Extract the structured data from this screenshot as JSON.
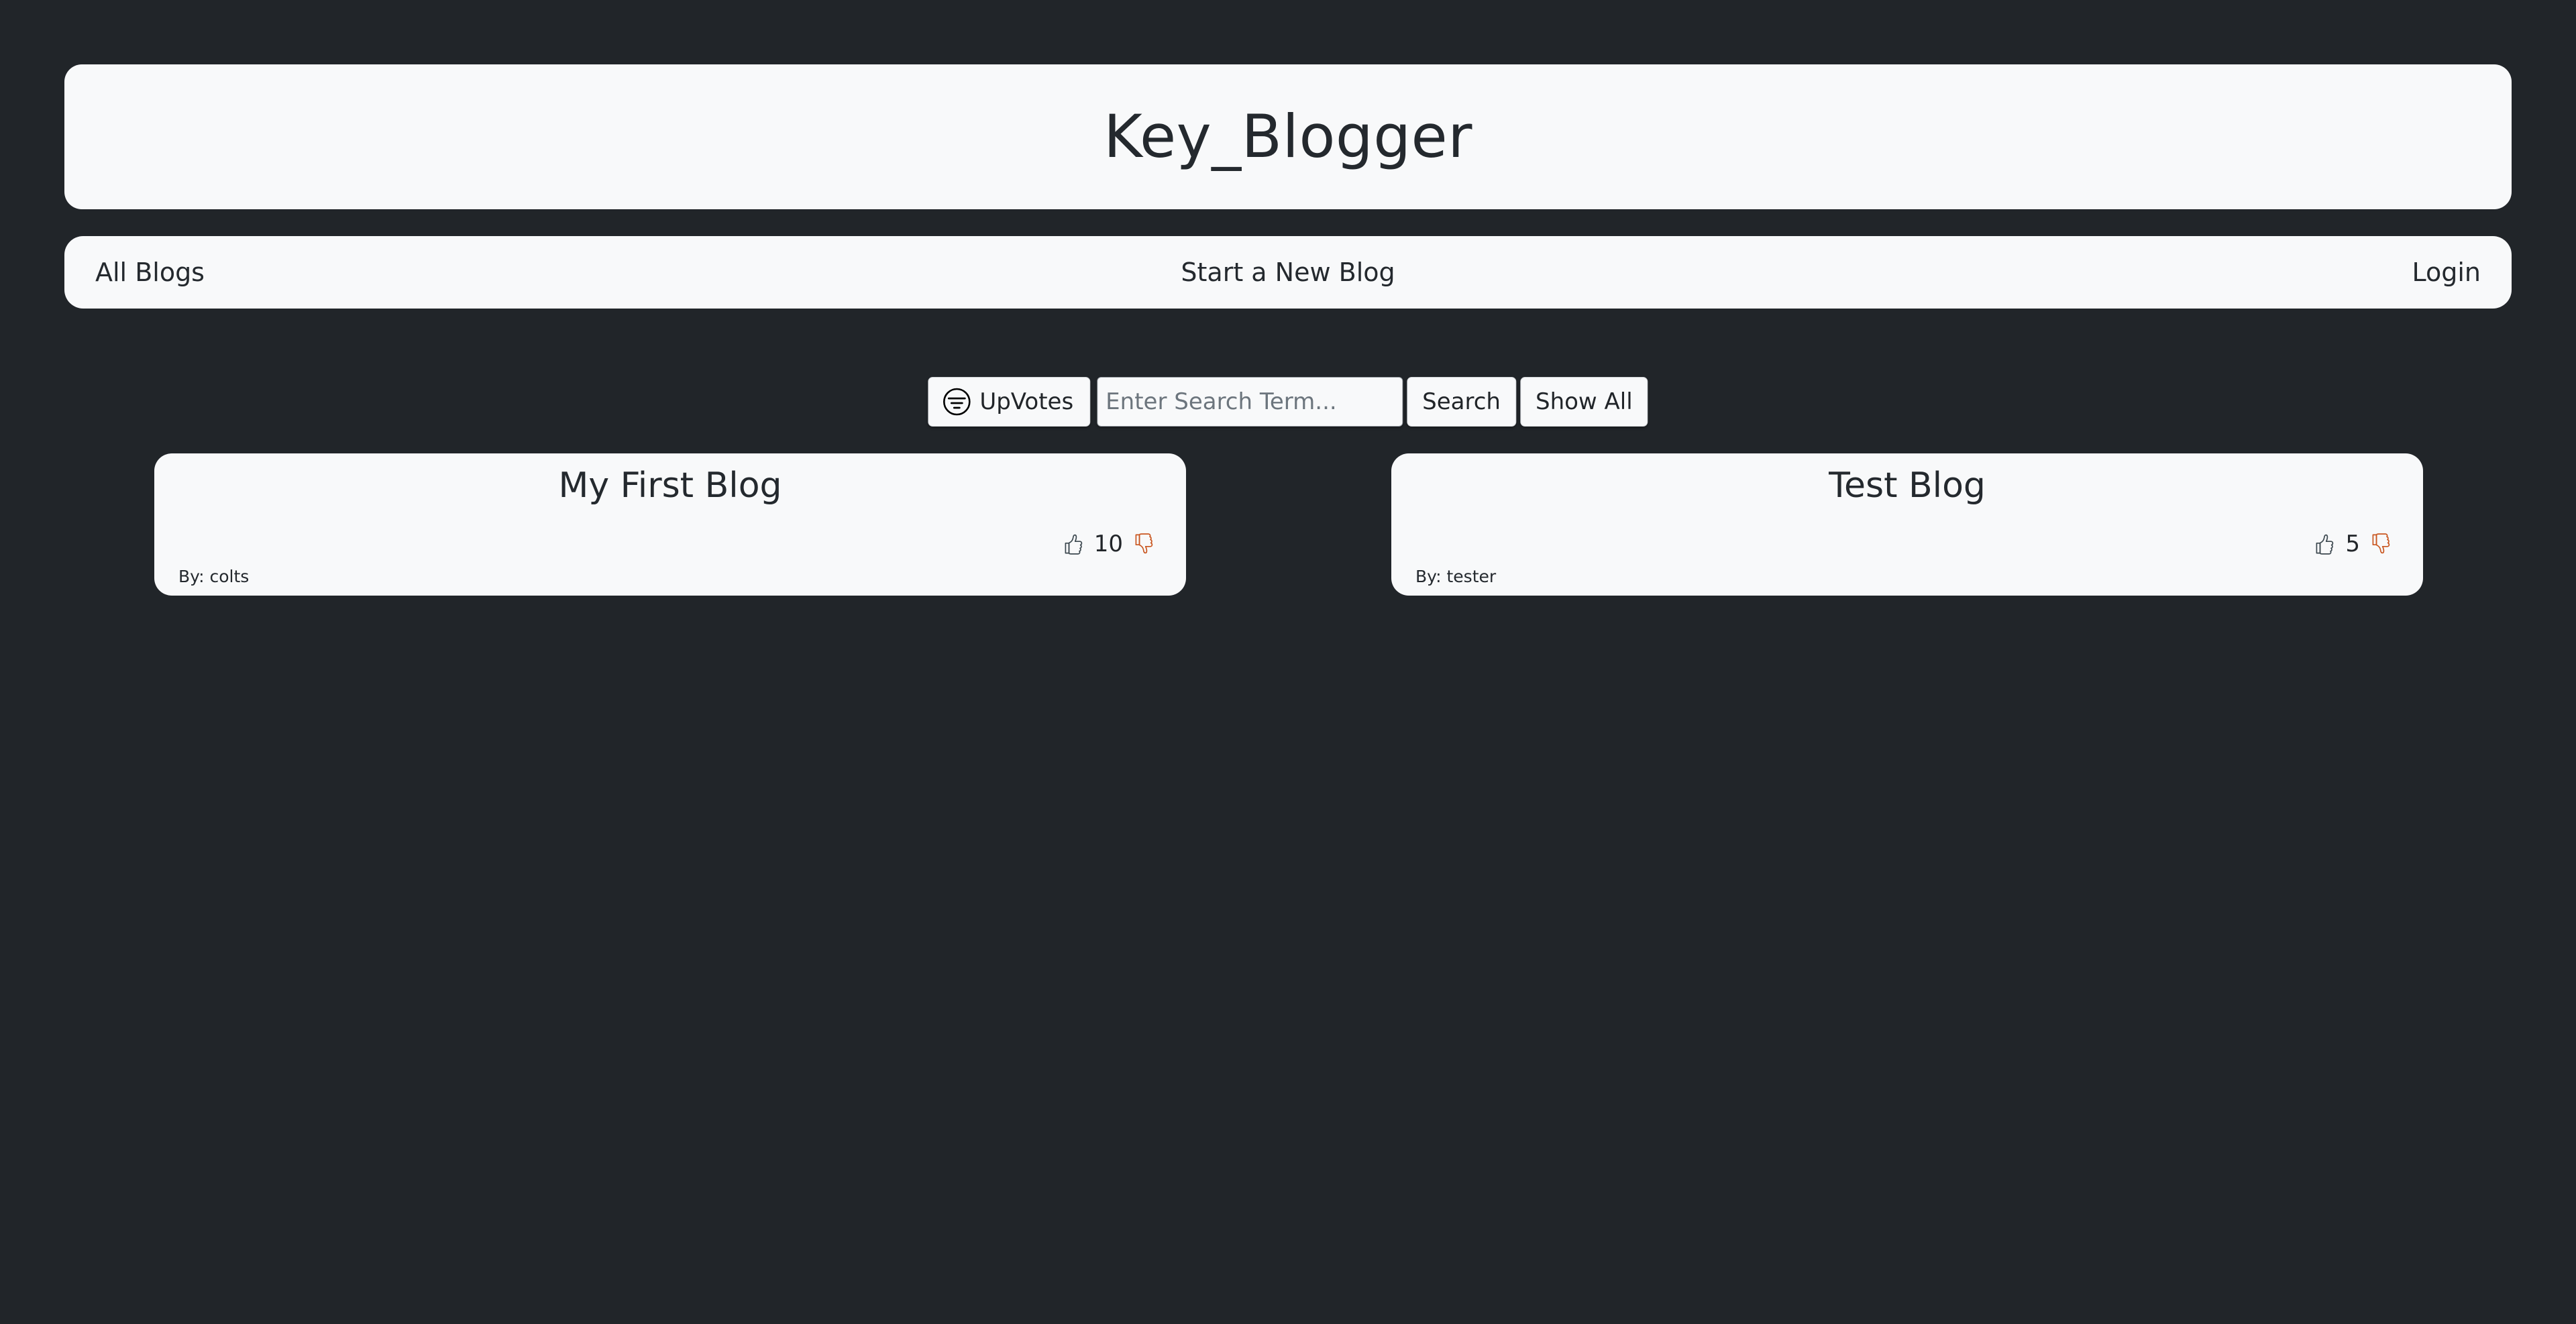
{
  "site": {
    "title": "Key_Blogger",
    "background_color": "#212529",
    "surface_color": "#f8f9fa",
    "accent_color": "#c9561f"
  },
  "nav": {
    "all_blogs": "All Blogs",
    "start_new_blog": "Start a New Blog",
    "login": "Login"
  },
  "controls": {
    "upvotes_label": "UpVotes",
    "upvotes_icon": "filter-sort-icon",
    "search_placeholder": "Enter Search Term...",
    "search_value": "",
    "search_button": "Search",
    "show_all_button": "Show All"
  },
  "blogs": [
    {
      "title": "My First Blog",
      "author_label": "By: colts",
      "votes": "10",
      "thumb_up_icon": "thumbs-up-icon",
      "thumb_down_icon": "thumbs-down-icon"
    },
    {
      "title": "Test Blog",
      "author_label": "By: tester",
      "votes": "5",
      "thumb_up_icon": "thumbs-up-icon",
      "thumb_down_icon": "thumbs-down-icon"
    }
  ]
}
